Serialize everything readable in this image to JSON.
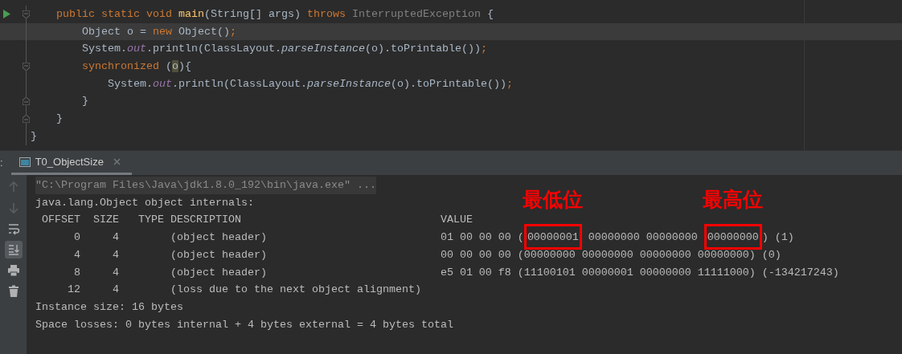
{
  "editor": {
    "lines": [
      {
        "kind": "method-header",
        "current": false,
        "tokens": [
          {
            "kind": "keyword",
            "text": "    public static void "
          },
          {
            "kind": "method",
            "text": "main"
          },
          {
            "kind": "plain",
            "text": "(String[] args) "
          },
          {
            "kind": "keyword",
            "text": "throws "
          },
          {
            "kind": "muted",
            "text": "InterruptedException"
          },
          {
            "kind": "plain",
            "text": " {"
          }
        ]
      },
      {
        "kind": "statement",
        "current": true,
        "tokens": [
          {
            "kind": "plain",
            "text": "        Object o = "
          },
          {
            "kind": "keyword",
            "text": "new "
          },
          {
            "kind": "plain",
            "text": "Object()"
          },
          {
            "kind": "keyword",
            "text": ";"
          }
        ]
      },
      {
        "kind": "statement",
        "current": false,
        "tokens": [
          {
            "kind": "plain",
            "text": "        System."
          },
          {
            "kind": "field",
            "text": "out"
          },
          {
            "kind": "plain",
            "text": ".println(ClassLayout."
          },
          {
            "kind": "static",
            "text": "parseInstance"
          },
          {
            "kind": "plain",
            "text": "(o).toPrintable())"
          },
          {
            "kind": "keyword",
            "text": ";"
          }
        ]
      },
      {
        "kind": "block-start",
        "current": false,
        "tokens": [
          {
            "kind": "keyword",
            "text": "        synchronized "
          },
          {
            "kind": "plain",
            "text": "("
          },
          {
            "kind": "match",
            "text": "o"
          },
          {
            "kind": "plain",
            "text": "){"
          }
        ]
      },
      {
        "kind": "statement",
        "current": false,
        "tokens": [
          {
            "kind": "plain",
            "text": "            System."
          },
          {
            "kind": "field",
            "text": "out"
          },
          {
            "kind": "plain",
            "text": ".println(ClassLayout."
          },
          {
            "kind": "static",
            "text": "parseInstance"
          },
          {
            "kind": "plain",
            "text": "(o).toPrintable())"
          },
          {
            "kind": "keyword",
            "text": ";"
          }
        ]
      },
      {
        "kind": "block-end",
        "current": false,
        "tokens": [
          {
            "kind": "plain",
            "text": "        }"
          }
        ]
      },
      {
        "kind": "block-end",
        "current": false,
        "tokens": [
          {
            "kind": "plain",
            "text": "    }"
          }
        ]
      },
      {
        "kind": "statement",
        "current": false,
        "tokens": [
          {
            "kind": "plain",
            "text": "}"
          }
        ]
      }
    ]
  },
  "run_panel": {
    "label": ":",
    "tabs": [
      {
        "label": "T0_ObjectSize",
        "selected": true
      }
    ],
    "tools": [
      {
        "kind": "up",
        "disabled": true,
        "on": false
      },
      {
        "kind": "down",
        "disabled": true,
        "on": false
      },
      {
        "kind": "wrap",
        "disabled": false,
        "on": false
      },
      {
        "kind": "scroll-end",
        "disabled": false,
        "on": true
      },
      {
        "kind": "print",
        "disabled": false,
        "on": false
      },
      {
        "kind": "trash",
        "disabled": false,
        "on": false
      }
    ],
    "console": [
      {
        "kind": "command",
        "segments": [
          {
            "text": "\"C:\\Program Files\\Java\\jdk1.8.0_192\\bin\\java.exe\" ..."
          }
        ]
      },
      {
        "kind": "output",
        "segments": [
          {
            "text": "java.lang.Object object internals:"
          }
        ]
      },
      {
        "kind": "output",
        "segments": [
          {
            "text": " OFFSET  SIZE   TYPE DESCRIPTION                               VALUE"
          }
        ]
      },
      {
        "kind": "output",
        "segments": [
          {
            "text": "      0     4        (object header)                           01 00 00 00 ("
          },
          {
            "text": "00000001",
            "annotation": "最低位"
          },
          {
            "text": " 00000000 00000000 "
          },
          {
            "text": "00000000",
            "annotation": "最高位"
          },
          {
            "text": ") (1)"
          }
        ]
      },
      {
        "kind": "output",
        "segments": [
          {
            "text": "      4     4        (object header)                           00 00 00 00 (00000000 00000000 00000000 00000000) (0)"
          }
        ]
      },
      {
        "kind": "output",
        "segments": [
          {
            "text": "      8     4        (object header)                           e5 01 00 f8 (11100101 00000001 00000000 11111000) (-134217243)"
          }
        ]
      },
      {
        "kind": "output",
        "segments": [
          {
            "text": "     12     4        (loss due to the next object alignment)"
          }
        ]
      },
      {
        "kind": "output",
        "segments": [
          {
            "text": "Instance size: 16 bytes"
          }
        ]
      },
      {
        "kind": "output",
        "segments": [
          {
            "text": "Space losses: 0 bytes internal + 4 bytes external = 4 bytes total"
          }
        ]
      }
    ]
  }
}
